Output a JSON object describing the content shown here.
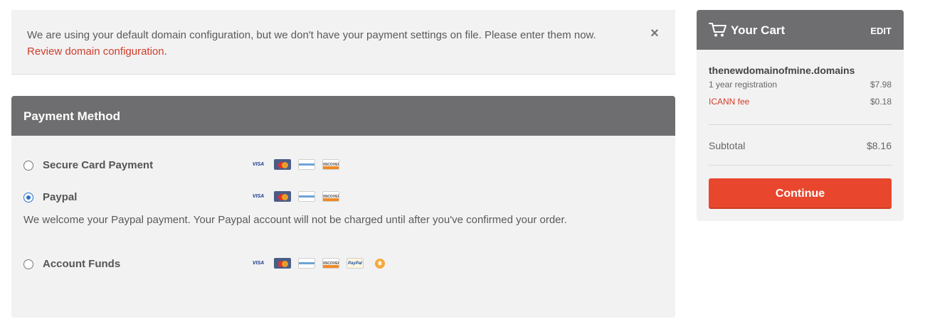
{
  "notice": {
    "message": "We are using your default domain configuration, but we don't have your payment settings on file. Please enter them now.",
    "link_text": "Review domain configuration",
    "link_suffix": "."
  },
  "payment": {
    "title": "Payment Method",
    "options": [
      {
        "label": "Secure Card Payment",
        "selected": false,
        "icons": [
          "visa-icon",
          "mastercard-icon",
          "amex-icon",
          "discover-icon"
        ]
      },
      {
        "label": "Paypal",
        "selected": true,
        "icons": [
          "visa-icon",
          "mastercard-icon",
          "amex-icon",
          "discover-icon"
        ]
      },
      {
        "label": "Account Funds",
        "selected": false,
        "icons": [
          "visa-icon",
          "mastercard-icon",
          "amex-icon",
          "discover-icon",
          "paypal-icon",
          "bitcoin-icon"
        ]
      }
    ],
    "paypal_note": "We welcome your Paypal payment. Your Paypal account will not be charged until after you've confirmed your order.",
    "icon_text": {
      "visa": "VISA",
      "discover": "DISCOVER",
      "paypal": "PayPal",
      "bitcoin": "฿"
    }
  },
  "cart": {
    "title": "Your Cart",
    "edit_label": "EDIT",
    "domain": "thenewdomainofmine.domains",
    "items": [
      {
        "label": "1 year registration",
        "value": "$7.98"
      },
      {
        "label": "ICANN fee",
        "value": "$0.18"
      }
    ],
    "subtotal_label": "Subtotal",
    "subtotal_value": "$8.16",
    "continue_label": "Continue"
  },
  "colors": {
    "accent": "#e8472e",
    "header": "#6e6e70",
    "link": "#d13c2a",
    "radio": "#2a6fcf"
  }
}
